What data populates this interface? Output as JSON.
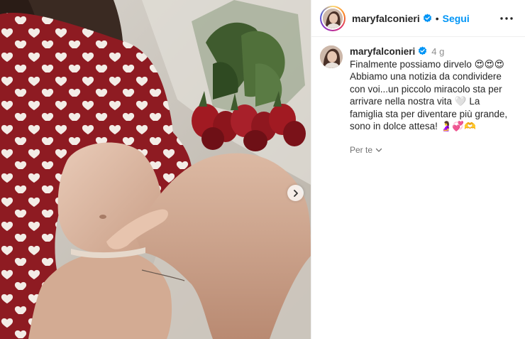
{
  "post": {
    "author": {
      "username": "maryfalconieri",
      "verified": true
    },
    "header": {
      "follow_label": "Segui",
      "separator": "•"
    },
    "caption": {
      "time_ago": "4 g",
      "line1": "Finalmente possiamo dirvelo 😍😍😍",
      "line2": "Abbiamo una notizia da condividere con voi...un piccolo miracolo sta per arrivare nella nostra vita 🤍 La famiglia sta per diventare più grande, sono in dolce attesa! 🤰💞🫶"
    },
    "translate_label": "Per te"
  },
  "colors": {
    "accent": "#0095f6",
    "pajama_red": "#8e1b22",
    "rose_red": "#a11a22",
    "leaf_green": "#3f5b2e"
  },
  "icons": {
    "next": "chevron-right-icon",
    "more": "more-horizontal-icon",
    "verified": "verified-badge-icon",
    "translate": "chevron-down-icon"
  }
}
